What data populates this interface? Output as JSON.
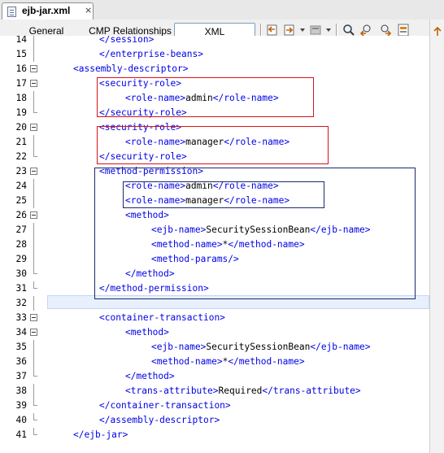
{
  "file_tab": {
    "name": "ejb-jar.xml",
    "close": "×"
  },
  "view_tabs": [
    "General",
    "CMP Relationships",
    "XML"
  ],
  "toolbar_icons": [
    "back-icon",
    "forward-icon",
    "source-icon",
    "find-icon",
    "prev-occurrence-icon",
    "next-occurrence-icon",
    "toggle-bookmark-icon"
  ],
  "lines": [
    {
      "num": "14",
      "indent": 4,
      "parts": [
        {
          "t": "tag",
          "v": "</session>"
        }
      ]
    },
    {
      "num": "15",
      "indent": 4,
      "parts": [
        {
          "t": "tag",
          "v": "</enterprise-beans>"
        }
      ]
    },
    {
      "num": "16",
      "indent": 2,
      "parts": [
        {
          "t": "tag",
          "v": "<assembly-descriptor>"
        }
      ]
    },
    {
      "num": "17",
      "indent": 4,
      "parts": [
        {
          "t": "tag",
          "v": "<security-role>"
        }
      ]
    },
    {
      "num": "18",
      "indent": 6,
      "parts": [
        {
          "t": "tag",
          "v": "<role-name>"
        },
        {
          "t": "txt",
          "v": "admin"
        },
        {
          "t": "tag",
          "v": "</role-name>"
        }
      ]
    },
    {
      "num": "19",
      "indent": 4,
      "parts": [
        {
          "t": "tag",
          "v": "</security-role>"
        }
      ]
    },
    {
      "num": "20",
      "indent": 4,
      "parts": [
        {
          "t": "tag",
          "v": "<security-role>"
        }
      ]
    },
    {
      "num": "21",
      "indent": 6,
      "parts": [
        {
          "t": "tag",
          "v": "<role-name>"
        },
        {
          "t": "txt",
          "v": "manager"
        },
        {
          "t": "tag",
          "v": "</role-name>"
        }
      ]
    },
    {
      "num": "22",
      "indent": 4,
      "parts": [
        {
          "t": "tag",
          "v": "</security-role>"
        }
      ]
    },
    {
      "num": "23",
      "indent": 4,
      "parts": [
        {
          "t": "tag",
          "v": "<method-permission>"
        }
      ]
    },
    {
      "num": "24",
      "indent": 6,
      "parts": [
        {
          "t": "tag",
          "v": "<role-name>"
        },
        {
          "t": "txt",
          "v": "admin"
        },
        {
          "t": "tag",
          "v": "</role-name>"
        }
      ]
    },
    {
      "num": "25",
      "indent": 6,
      "parts": [
        {
          "t": "tag",
          "v": "<role-name>"
        },
        {
          "t": "txt",
          "v": "manager"
        },
        {
          "t": "tag",
          "v": "</role-name>"
        }
      ]
    },
    {
      "num": "26",
      "indent": 6,
      "parts": [
        {
          "t": "tag",
          "v": "<method>"
        }
      ]
    },
    {
      "num": "27",
      "indent": 8,
      "parts": [
        {
          "t": "tag",
          "v": "<ejb-name>"
        },
        {
          "t": "txt",
          "v": "SecuritySessionBean"
        },
        {
          "t": "tag",
          "v": "</ejb-name>"
        }
      ]
    },
    {
      "num": "28",
      "indent": 8,
      "parts": [
        {
          "t": "tag",
          "v": "<method-name>"
        },
        {
          "t": "txt",
          "v": "*"
        },
        {
          "t": "tag",
          "v": "</method-name>"
        }
      ]
    },
    {
      "num": "29",
      "indent": 8,
      "parts": [
        {
          "t": "tag",
          "v": "<method-params/>"
        }
      ]
    },
    {
      "num": "30",
      "indent": 6,
      "parts": [
        {
          "t": "tag",
          "v": "</method>"
        }
      ]
    },
    {
      "num": "31",
      "indent": 4,
      "parts": [
        {
          "t": "tag",
          "v": "</method-permission>"
        }
      ]
    },
    {
      "num": "32",
      "indent": 0,
      "parts": []
    },
    {
      "num": "33",
      "indent": 4,
      "parts": [
        {
          "t": "tag",
          "v": "<container-transaction>"
        }
      ]
    },
    {
      "num": "34",
      "indent": 6,
      "parts": [
        {
          "t": "tag",
          "v": "<method>"
        }
      ]
    },
    {
      "num": "35",
      "indent": 8,
      "parts": [
        {
          "t": "tag",
          "v": "<ejb-name>"
        },
        {
          "t": "txt",
          "v": "SecuritySessionBean"
        },
        {
          "t": "tag",
          "v": "</ejb-name>"
        }
      ]
    },
    {
      "num": "36",
      "indent": 8,
      "parts": [
        {
          "t": "tag",
          "v": "<method-name>"
        },
        {
          "t": "txt",
          "v": "*"
        },
        {
          "t": "tag",
          "v": "</method-name>"
        }
      ]
    },
    {
      "num": "37",
      "indent": 6,
      "parts": [
        {
          "t": "tag",
          "v": "</method>"
        }
      ]
    },
    {
      "num": "38",
      "indent": 6,
      "parts": [
        {
          "t": "tag",
          "v": "<trans-attribute>"
        },
        {
          "t": "txt",
          "v": "Required"
        },
        {
          "t": "tag",
          "v": "</trans-attribute>"
        }
      ]
    },
    {
      "num": "39",
      "indent": 4,
      "parts": [
        {
          "t": "tag",
          "v": "</container-transaction>"
        }
      ]
    },
    {
      "num": "40",
      "indent": 4,
      "parts": [
        {
          "t": "tag",
          "v": "</assembly-descriptor>"
        }
      ]
    },
    {
      "num": "41",
      "indent": 2,
      "parts": [
        {
          "t": "tag",
          "v": "</ejb-jar>"
        }
      ]
    }
  ],
  "folds": {
    "open": [
      "16",
      "17",
      "20",
      "23",
      "26",
      "33",
      "34"
    ],
    "close": [
      "19",
      "22",
      "30",
      "31",
      "37",
      "39",
      "40",
      "41"
    ]
  },
  "colors": {
    "tag": "#0000e6",
    "text": "#000000",
    "highlight_red": "#d4141a",
    "highlight_navy": "#1c2a6e",
    "current_line": "#e8f0fe"
  }
}
